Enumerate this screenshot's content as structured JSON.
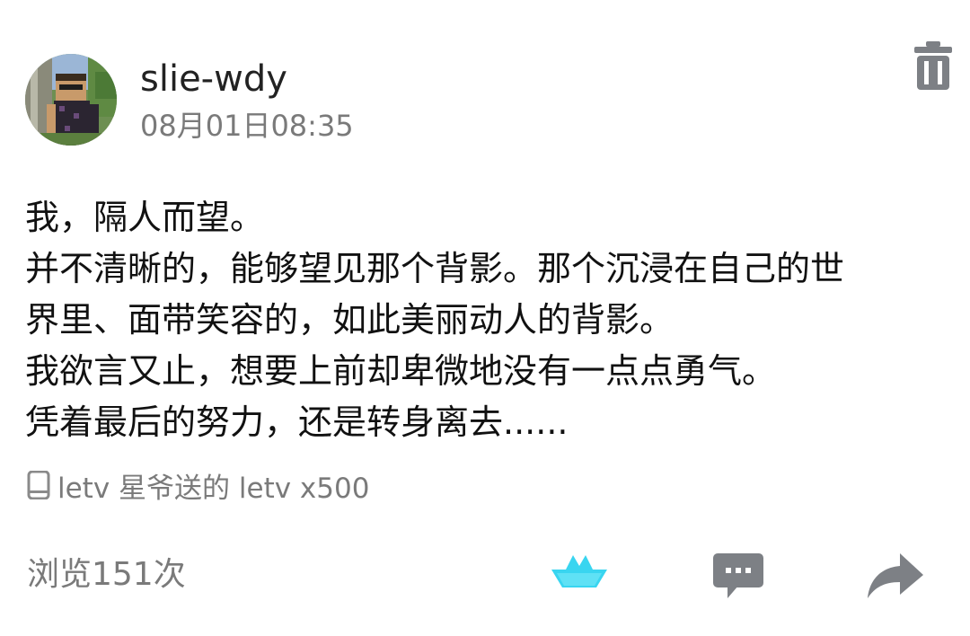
{
  "post": {
    "author": "slie-wdy",
    "timestamp": "08月01日08:35",
    "lines": [
      "我，隔人而望。",
      "并不清晰的，能够望见那个背影。那个沉浸在自己的世",
      "界里、面带笑容的，如此美丽动人的背影。",
      "我欲言又止，想要上前却卑微地没有一点点勇气。",
      "凭着最后的努力，还是转身离去......"
    ],
    "device_text": "letv 星爷送的 letv x500",
    "views_text": "浏览151次"
  },
  "icons": {
    "delete": "trash-icon",
    "device": "phone-icon",
    "boat": "boat-icon",
    "comment": "comment-icon",
    "share": "share-icon"
  },
  "colors": {
    "text_primary": "#111111",
    "text_secondary": "#7a7a7a",
    "icon_gray": "#7d8085",
    "boat_accent": "#39d5f0"
  }
}
